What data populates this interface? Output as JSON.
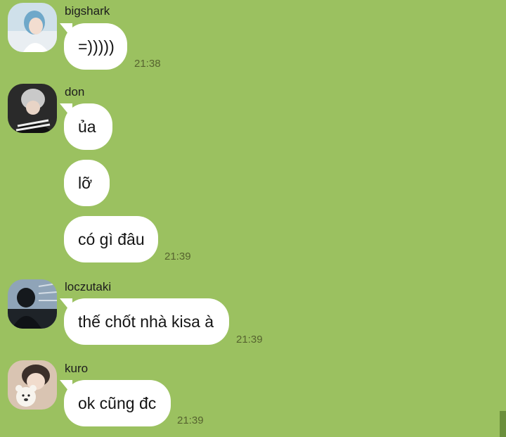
{
  "colors": {
    "background": "#9bc160",
    "bubble": "#ffffff",
    "timestamp": "#56632f"
  },
  "messages": [
    {
      "username": "bigshark",
      "avatar": "bigshark-avatar",
      "bubbles": [
        {
          "text": "=)))))"
        }
      ],
      "time": "21:38"
    },
    {
      "username": "don",
      "avatar": "don-avatar",
      "bubbles": [
        {
          "text": "ủa"
        },
        {
          "text": "lỡ"
        },
        {
          "text": "có gì đâu"
        }
      ],
      "time": "21:39"
    },
    {
      "username": "loczutaki",
      "avatar": "loczutaki-avatar",
      "bubbles": [
        {
          "text": "thế chốt nhà kisa à"
        }
      ],
      "time": "21:39"
    },
    {
      "username": "kuro",
      "avatar": "kuro-avatar",
      "bubbles": [
        {
          "text": "ok cũng đc"
        }
      ],
      "time": "21:39"
    }
  ]
}
